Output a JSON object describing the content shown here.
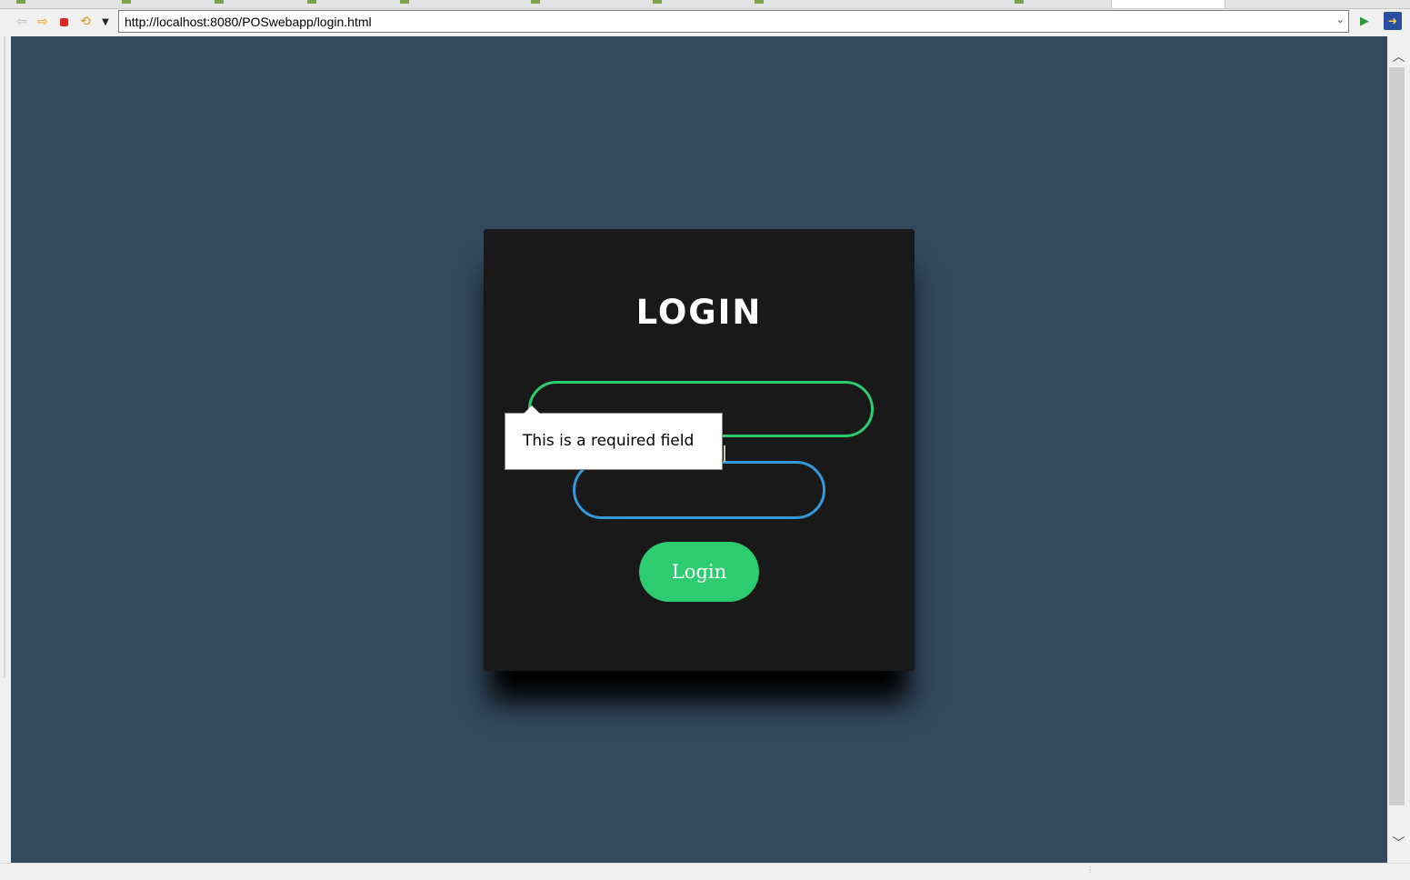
{
  "browser": {
    "url": "http://localhost:8080/POSwebapp/login.html",
    "icons": {
      "back": "back-arrow-icon",
      "forward": "forward-arrow-icon",
      "stop": "stop-icon",
      "refresh": "refresh-icon",
      "menu": "dropdown-icon",
      "go": "go-icon",
      "open_external": "external-browser-icon"
    }
  },
  "login": {
    "title": "LOGIN",
    "username_value": "",
    "password_value": "",
    "button_label": "Login",
    "validation_message": "This is a required field"
  },
  "colors": {
    "page_background": "#34495e",
    "card_background": "#191919",
    "username_border": "#2ecc71",
    "password_border": "#3498db",
    "button_background": "#2ecc71"
  }
}
